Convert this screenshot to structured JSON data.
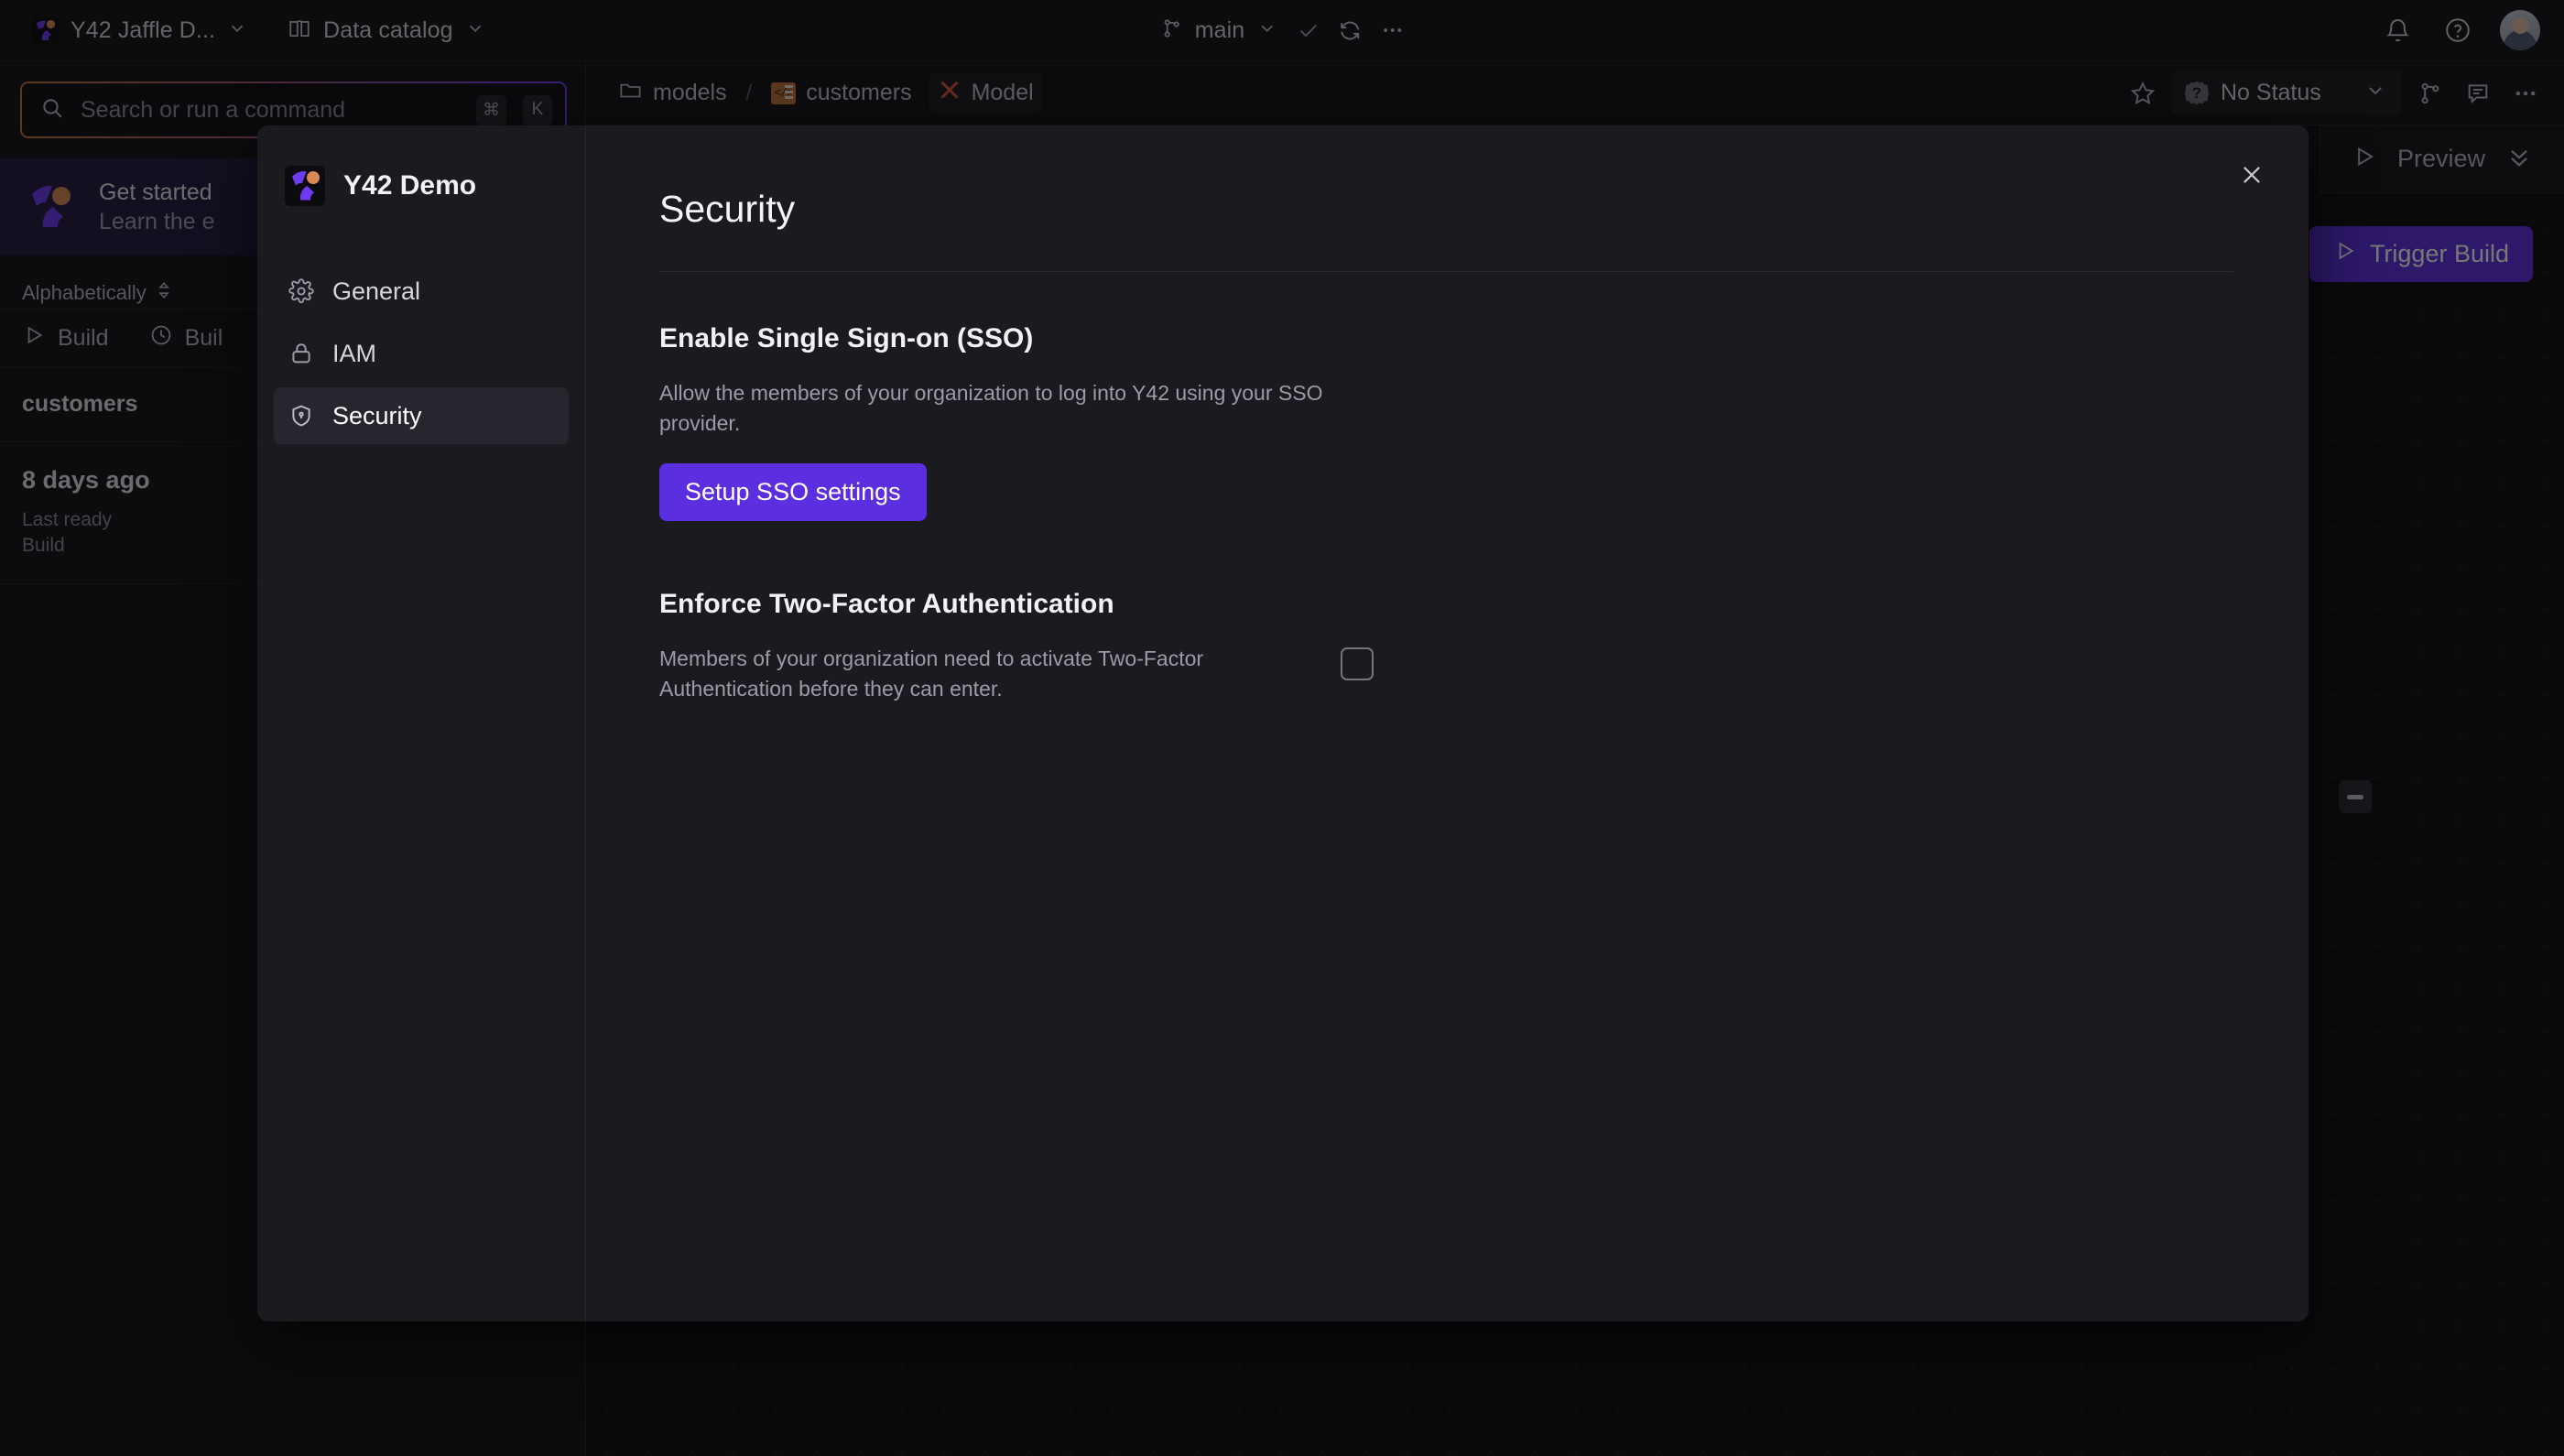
{
  "topbar": {
    "workspace_label": "Y42 Jaffle D...",
    "catalog_label": "Data catalog",
    "branch_label": "main",
    "icons": {
      "workspace_logo": "y42-logo-icon",
      "workspace_chevron": "chevron-down-icon",
      "catalog_book": "book-icon",
      "catalog_chevron": "chevron-down-icon",
      "branch": "git-branch-icon",
      "check": "check-icon",
      "sync": "sync-icon",
      "more": "more-horizontal-icon",
      "bell": "bell-icon",
      "help": "help-circle-icon",
      "avatar": "user-avatar"
    }
  },
  "breadcrumb": {
    "folder_label": "models",
    "separator": "/",
    "table_label": "customers",
    "model_label": "Model",
    "icons": {
      "folder": "folder-icon",
      "table": "table-code-icon",
      "model": "dbt-x-icon"
    }
  },
  "breadcrumb_actions": {
    "status_label": "No Status",
    "icons": {
      "star": "star-icon",
      "status_badge": "badge-question-icon",
      "status_chevron": "chevron-down-icon",
      "branch": "git-branch-icon",
      "comment": "comment-icon",
      "more": "more-horizontal-icon"
    }
  },
  "sidebar": {
    "search": {
      "placeholder": "Search or run a command",
      "value": "",
      "shortcut_cmd": "⌘",
      "shortcut_key": "K",
      "icon": "search-icon"
    },
    "promo": {
      "title": "Get started",
      "subtitle": "Learn the e",
      "icon": "y42-logo-icon"
    },
    "sort_label": "Alphabetically",
    "sort_icon": "sort-updown-icon",
    "build_actions": [
      {
        "label": "Build",
        "icon": "play-icon"
      },
      {
        "label": "Buil",
        "icon": "clock-icon"
      }
    ],
    "rows": [
      {
        "name": "customers"
      }
    ],
    "meta": {
      "time": "8 days ago",
      "sub_line1": "Last ready",
      "sub_line2": "Build"
    }
  },
  "canvas": {
    "preview_label": "Preview",
    "preview_icon": "play-icon",
    "collapse_icon": "chevrons-down-icon",
    "trigger_label": "Trigger Build",
    "trigger_icon": "play-icon",
    "minimize_icon": "minimize-icon"
  },
  "modal": {
    "org_name": "Y42 Demo",
    "org_logo_icon": "y42-logo-icon",
    "close_icon": "close-icon",
    "nav": [
      {
        "label": "General",
        "icon": "gear-icon",
        "active": false
      },
      {
        "label": "IAM",
        "icon": "lock-icon",
        "active": false
      },
      {
        "label": "Security",
        "icon": "shield-icon",
        "active": true
      }
    ],
    "title": "Security",
    "sso": {
      "heading": "Enable Single Sign-on (SSO)",
      "description": "Allow the members of your organization to log into Y42 using your SSO provider.",
      "button_label": "Setup SSO settings"
    },
    "twofa": {
      "heading": "Enforce Two-Factor Authentication",
      "description": "Members of your organization need to activate Two-Factor Authentication before they can enter.",
      "checked": false
    }
  },
  "colors": {
    "accent_purple": "#5b2ee0",
    "brand_orange": "#d98a52",
    "app_bg": "#131316",
    "modal_bg": "#1a1a1f"
  }
}
